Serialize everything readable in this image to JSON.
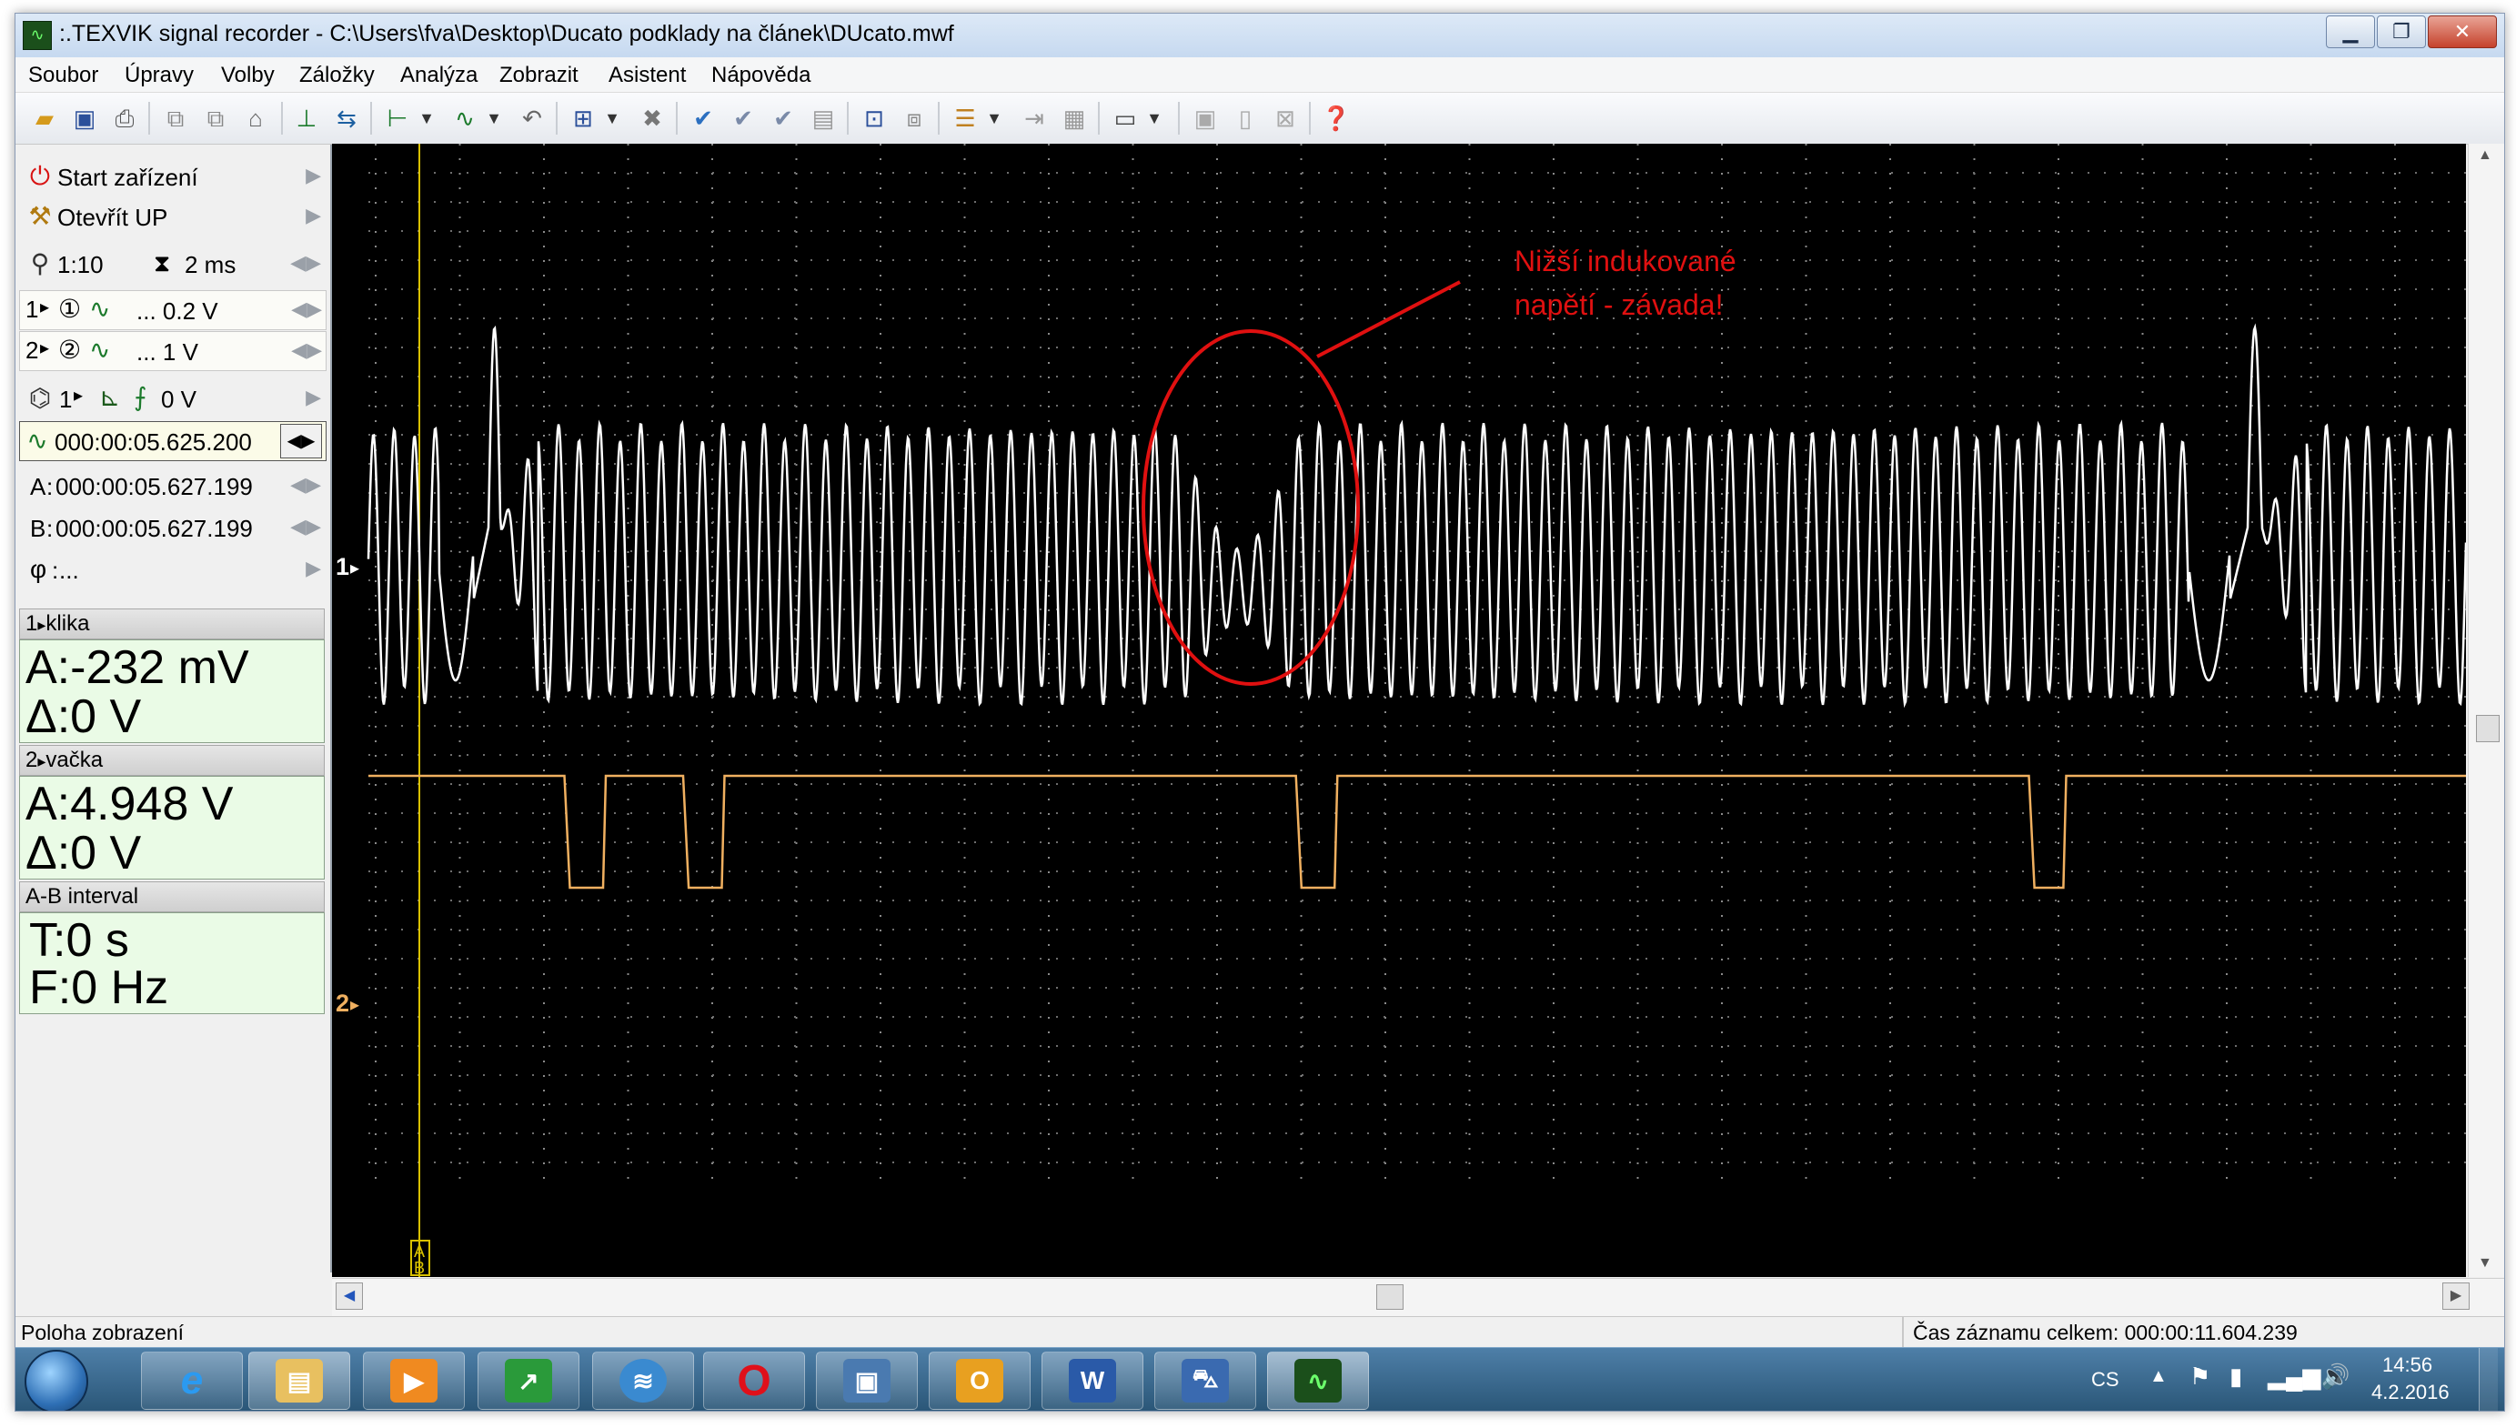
{
  "window": {
    "title": ":.TEXVIK  signal recorder - C:\\Users\\fva\\Desktop\\Ducato podklady na článek\\DUcato.mwf",
    "icon": "scope-app-icon",
    "controls": [
      "minimize-icon",
      "maximize-icon",
      "close-icon"
    ]
  },
  "menu": [
    "Soubor",
    "Úpravy",
    "Volby",
    "Záložky",
    "Analýza",
    "Zobrazit",
    "Asistent",
    "Nápověda"
  ],
  "toolbar_icons": [
    "open-folder-icon",
    "save-icon",
    "print-icon",
    "copy-icon",
    "paste-icon",
    "stamp-icon",
    "cursor-a-icon",
    "cursor-move-icon",
    "measure-icon",
    "wave-icon",
    "undo-icon",
    "zoom-icon",
    "delete-icon",
    "check-icon",
    "check-down-icon",
    "check-all-icon",
    "page-icon",
    "grid-icon",
    "layers-icon",
    "align-icon",
    "step-icon",
    "stop-icon",
    "display-icon",
    "window-icon",
    "book-icon",
    "close-x-icon",
    "help-icon"
  ],
  "left_panel": {
    "start": "Start zařízení",
    "open_up": "Otevřít UP",
    "zoom": "1:10",
    "timebase": "2 ms",
    "ch1": {
      "num": "1",
      "scale": "... 0.2 V"
    },
    "ch2": {
      "num": "2",
      "scale": "... 1 V"
    },
    "trigger": {
      "ch": "1",
      "level": "0 V"
    },
    "position": "000:00:05.625.200",
    "cursor_a": {
      "label": "A",
      "value": "000:00:05.627.199"
    },
    "cursor_b": {
      "label": "B",
      "value": "000:00:05.627.199"
    },
    "phi": {
      "label": "φ",
      "value": "..."
    }
  },
  "channel_boxes": [
    {
      "header": "klika",
      "num": "1",
      "a": "A:-232 mV",
      "d": "Δ:0 V"
    },
    {
      "header": "vačka",
      "num": "2",
      "a": "A:4.948 V",
      "d": "Δ:0 V"
    }
  ],
  "interval": {
    "header": "A-B interval",
    "t": "T:0 s",
    "f": "F:0 Hz"
  },
  "scope": {
    "ch1_marker": "1",
    "ch2_marker": "2",
    "cursor_letters": [
      "A",
      "B"
    ],
    "annotation_line1": "Nižší indukované",
    "annotation_line2": "napětí - závada!",
    "ch1_color": "#ffffff",
    "ch2_color": "#f0b060",
    "annotation_color": "#e01010"
  },
  "status": {
    "left": "Poloha zobrazení",
    "right": "Čas záznamu celkem: 000:00:11.604.239"
  },
  "taskbar": {
    "apps": [
      "start-orb-icon",
      "ie-icon",
      "explorer-icon",
      "media-icon",
      "chart-app-icon",
      "network-app-icon",
      "opera-icon",
      "video-icon",
      "outlook-icon",
      "word-icon",
      "car-app-icon",
      "texvik-icon"
    ],
    "lang": "CS",
    "time": "14:56",
    "date": "4.2.2016"
  }
}
